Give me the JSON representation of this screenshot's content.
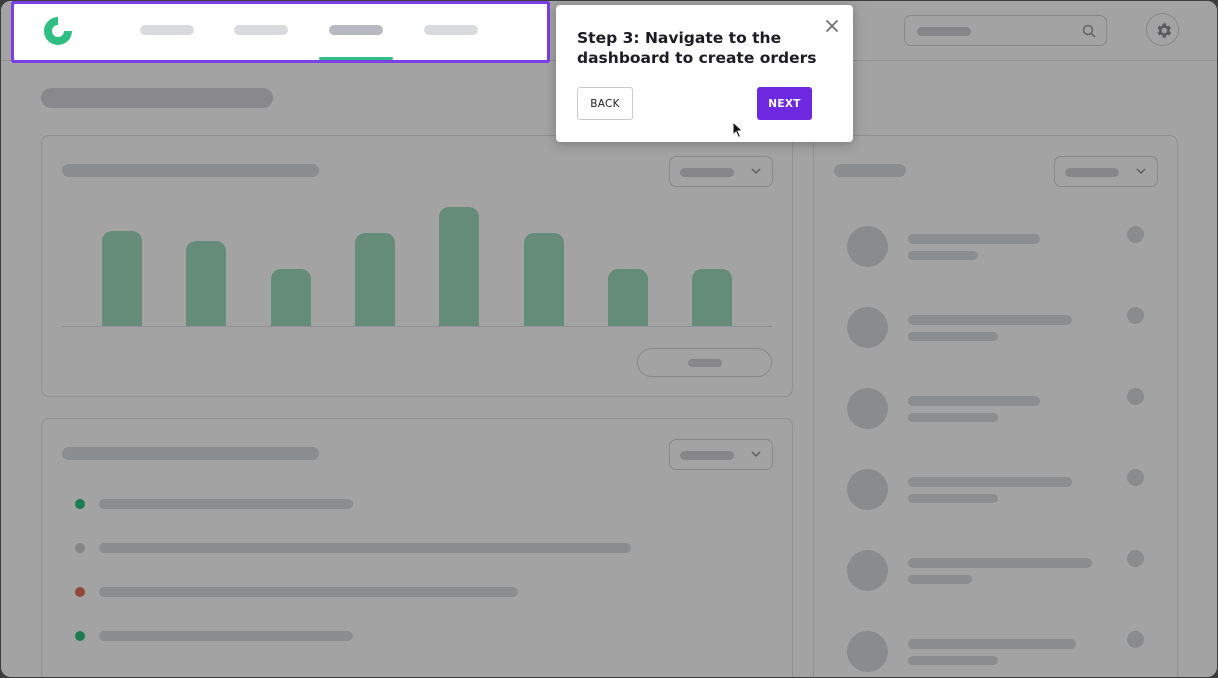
{
  "tour": {
    "title": "Step 3: Navigate to the dashboard to create orders",
    "back_label": "BACK",
    "next_label": "NEXT"
  },
  "colors": {
    "accent": "#6d28e0",
    "spotlight_border": "#7b3fe4",
    "brand_green": "#2fbf82",
    "status_green": "#2fbf82",
    "status_grey": "#d0d1d4",
    "status_red": "#e0725f"
  },
  "icons": {
    "logo": "brand-logo",
    "search": "search-icon",
    "settings": "gear-icon",
    "close": "close-icon",
    "dropdown": "chevron-down-icon",
    "pointer": "mouse-cursor"
  }
}
